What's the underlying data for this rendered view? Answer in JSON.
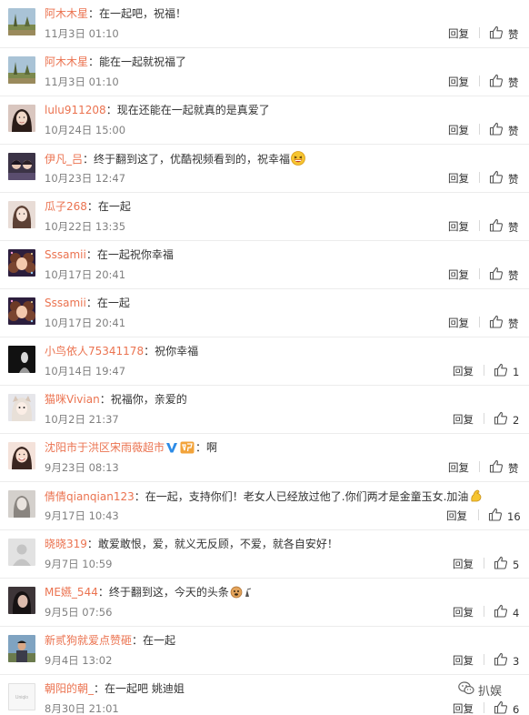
{
  "comments": [
    {
      "user": "阿木木星",
      "text": "在一起吧，祝福！",
      "time": "11月3日 01:10",
      "reply": "回复",
      "likes": "赞",
      "avatar": "landscape"
    },
    {
      "user": "阿木木星",
      "text": "能在一起就祝福了",
      "time": "11月3日 01:10",
      "reply": "回复",
      "likes": "赞",
      "avatar": "landscape"
    },
    {
      "user": "lulu911208",
      "text": "现在还能在一起就真的是真爱了",
      "time": "10月24日 15:00",
      "reply": "回复",
      "likes": "赞",
      "avatar": "woman-dark"
    },
    {
      "user": "伊凡_吕",
      "text": "终于翻到这了，优酷视频看到的，祝幸福",
      "time": "10月23日 12:47",
      "reply": "回复",
      "likes": "赞",
      "avatar": "group",
      "emoji": "laughing-emoji"
    },
    {
      "user": "瓜子268",
      "text": "在一起",
      "time": "10月22日 13:35",
      "reply": "回复",
      "likes": "赞",
      "avatar": "woman-light"
    },
    {
      "user": "Sssamii",
      "text": "在一起祝你幸福",
      "time": "10月17日 20:41",
      "reply": "回复",
      "likes": "赞",
      "avatar": "curly"
    },
    {
      "user": "Sssamii",
      "text": "在一起",
      "time": "10月17日 20:41",
      "reply": "回复",
      "likes": "赞",
      "avatar": "curly"
    },
    {
      "user": "小鸟依人75341178",
      "text": "祝你幸福",
      "time": "10月14日 19:47",
      "reply": "回复",
      "likes": "1",
      "avatar": "dark-silhouette"
    },
    {
      "user": "猫咪Vivian",
      "text": "祝福你，亲爱的",
      "time": "10月2日 21:37",
      "reply": "回复",
      "likes": "2",
      "avatar": "cat-girl"
    },
    {
      "user": "沈阳市于洪区宋雨薇超市",
      "text": "啊",
      "time": "9月23日 08:13",
      "reply": "回复",
      "likes": "赞",
      "avatar": "smiling-woman",
      "verified": true,
      "member": true
    },
    {
      "user": "倩倩qianqian123",
      "text": "在一起，支持你们！老女人已经放过他了.你们两才是金童玉女.加油",
      "time": "9月17日 10:43",
      "reply": "回复",
      "likes": "16",
      "avatar": "gray-woman",
      "emoji": "strong-arm-emoji"
    },
    {
      "user": "晓晓319",
      "text": "敢爱敢恨，爱，就义无反顾，不爱，就各自安好！",
      "time": "9月7日 10:59",
      "reply": "回复",
      "likes": "5",
      "avatar": "default-gray"
    },
    {
      "user": "ME嬿_544",
      "text": "终于翻到这，今天的头条",
      "time": "9月5日 07:56",
      "reply": "回复",
      "likes": "4",
      "avatar": "dark-hair",
      "emoji": "doge-emoji"
    },
    {
      "user": "新贰狗就爱点赞砸",
      "text": "在一起",
      "time": "9月4日 13:02",
      "reply": "回复",
      "likes": "3",
      "avatar": "man-outdoor"
    },
    {
      "user": "朝阳的朝_",
      "text": "在一起吧 姚迪姐",
      "time": "8月30日 21:01",
      "reply": "回复",
      "likes": "6",
      "avatar": "white-logo"
    }
  ],
  "colors": {
    "username": "#eb7350",
    "text": "#333333",
    "time": "#808080",
    "verified": "#2c8be6",
    "member": "#f2a33a"
  },
  "watermark": {
    "text": "扒娱",
    "icon": "wechat-icon"
  }
}
